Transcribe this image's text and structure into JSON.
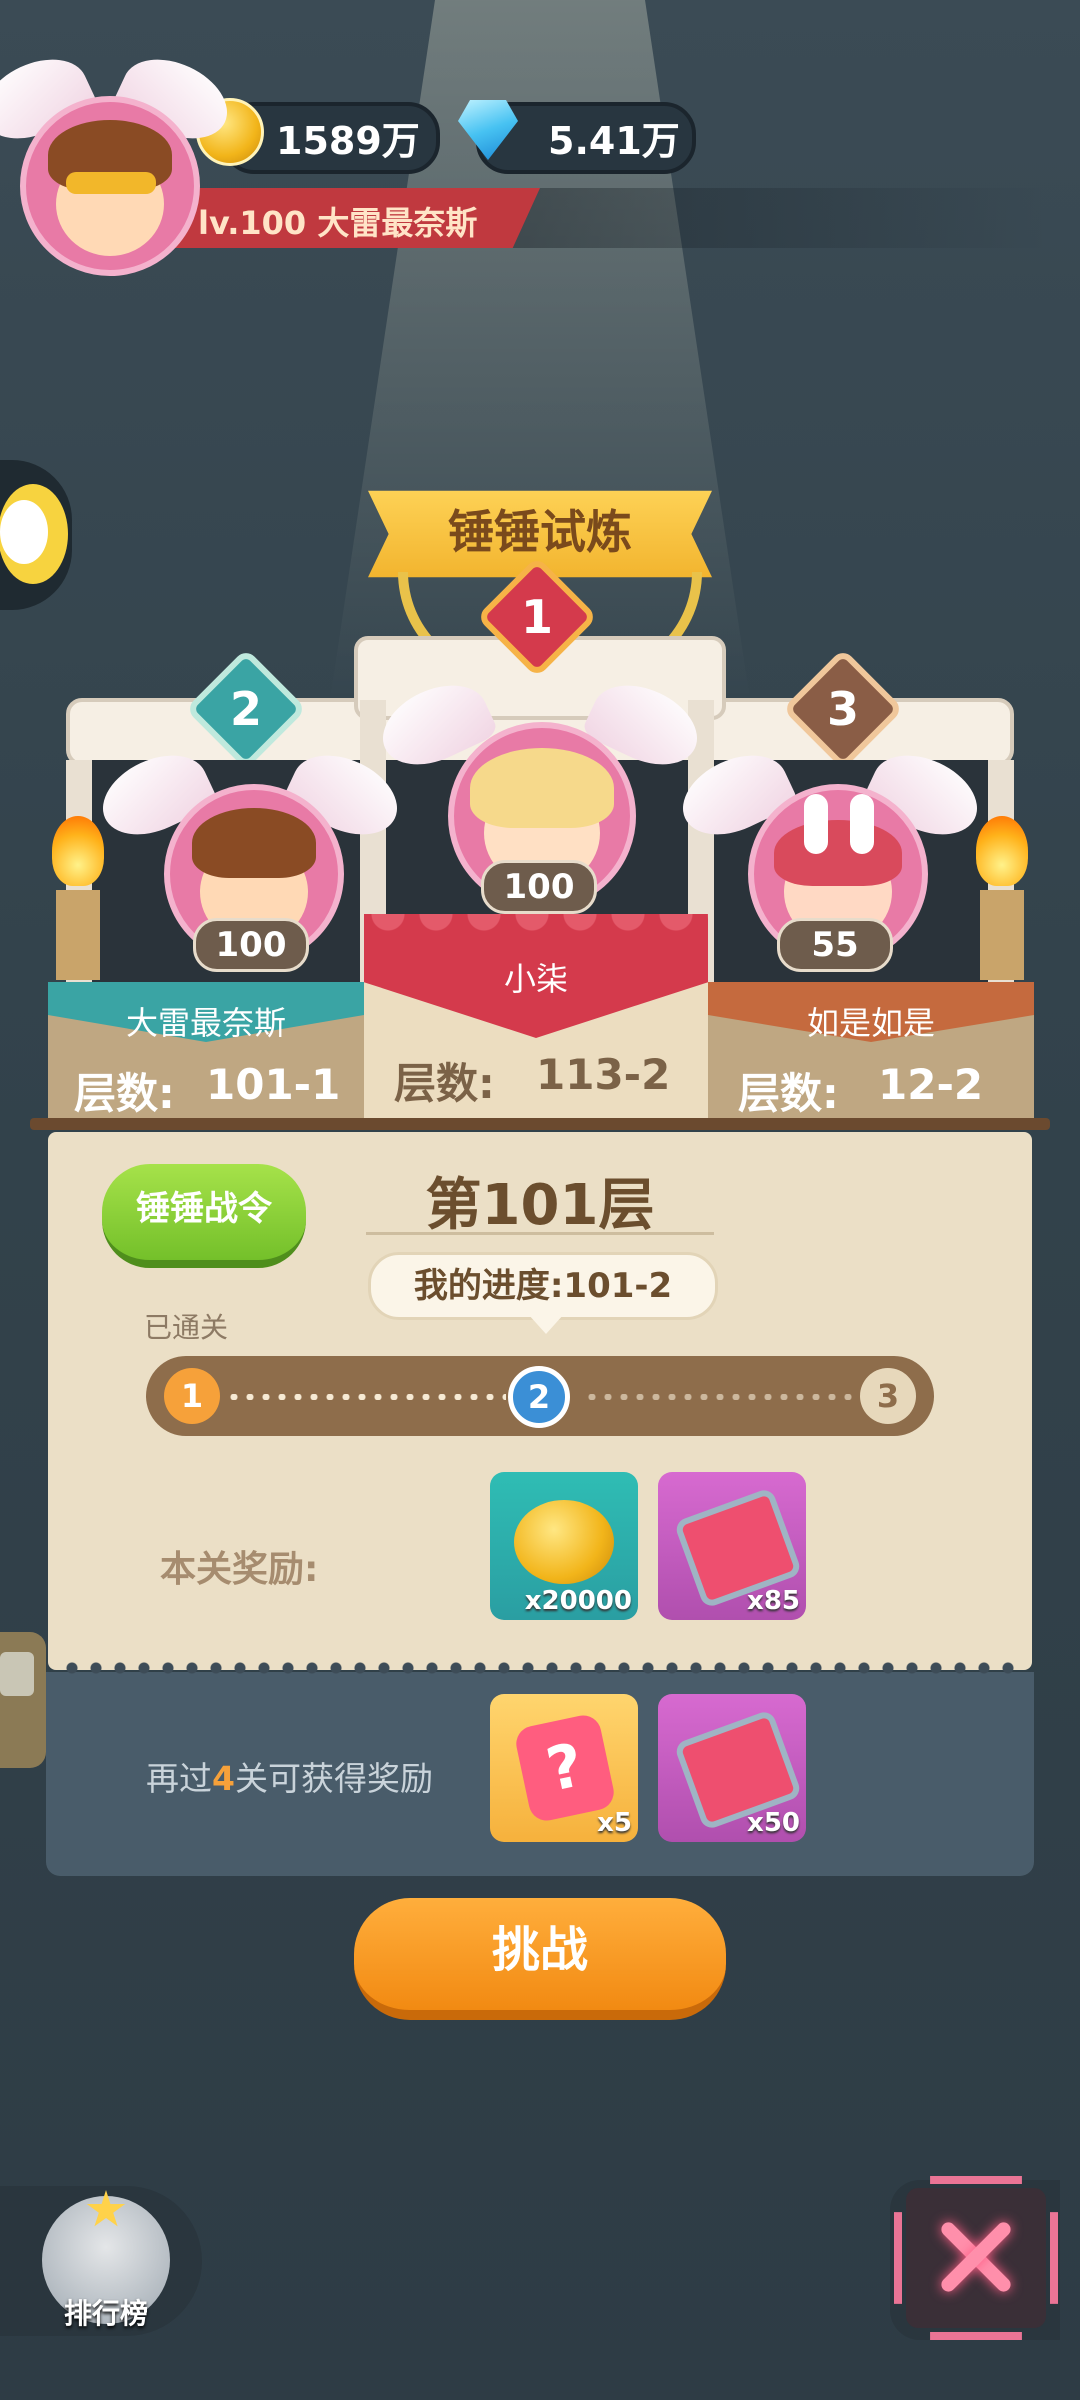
{
  "header": {
    "coins": "1589万",
    "gems": "5.41万",
    "player_level_name": "lv.100  大雷最奈斯"
  },
  "event": {
    "title": "锤锤试炼"
  },
  "podium": [
    {
      "rank": "1",
      "level": "100",
      "name": "小柒",
      "floor_label": "层数:",
      "floor": "113-2"
    },
    {
      "rank": "2",
      "level": "100",
      "name": "大雷最奈斯",
      "floor_label": "层数:",
      "floor": "101-1"
    },
    {
      "rank": "3",
      "level": "55",
      "name": "如是如是",
      "floor_label": "层数:",
      "floor": "12-2"
    }
  ],
  "panel": {
    "pass_button": "锤锤战令",
    "floor_title": "第101层",
    "my_progress": "我的进度:101-2",
    "cleared_label": "已通关",
    "nodes": [
      "1",
      "2",
      "3"
    ],
    "current_reward_label": "本关奖励:",
    "rewards": [
      {
        "icon": "coin-stack-icon",
        "count": "x20000"
      },
      {
        "icon": "ticket-scroll-icon",
        "count": "x85"
      }
    ],
    "milestone_prefix": "再过",
    "milestone_number": "4",
    "milestone_suffix": "关可获得奖励",
    "milestone_rewards": [
      {
        "icon": "mystery-hammer-icon",
        "count": "x5"
      },
      {
        "icon": "ticket-scroll-icon",
        "count": "x50"
      }
    ]
  },
  "challenge_button": "挑战",
  "leaderboard_label": "排行榜",
  "colors": {
    "accent_orange": "#f28a12",
    "accent_green": "#74c02a",
    "rank2_teal": "#3aa4a4",
    "rank1_red": "#d43a4c",
    "rank3_brown": "#c56a3e",
    "close_pink": "#ff7b9e"
  }
}
